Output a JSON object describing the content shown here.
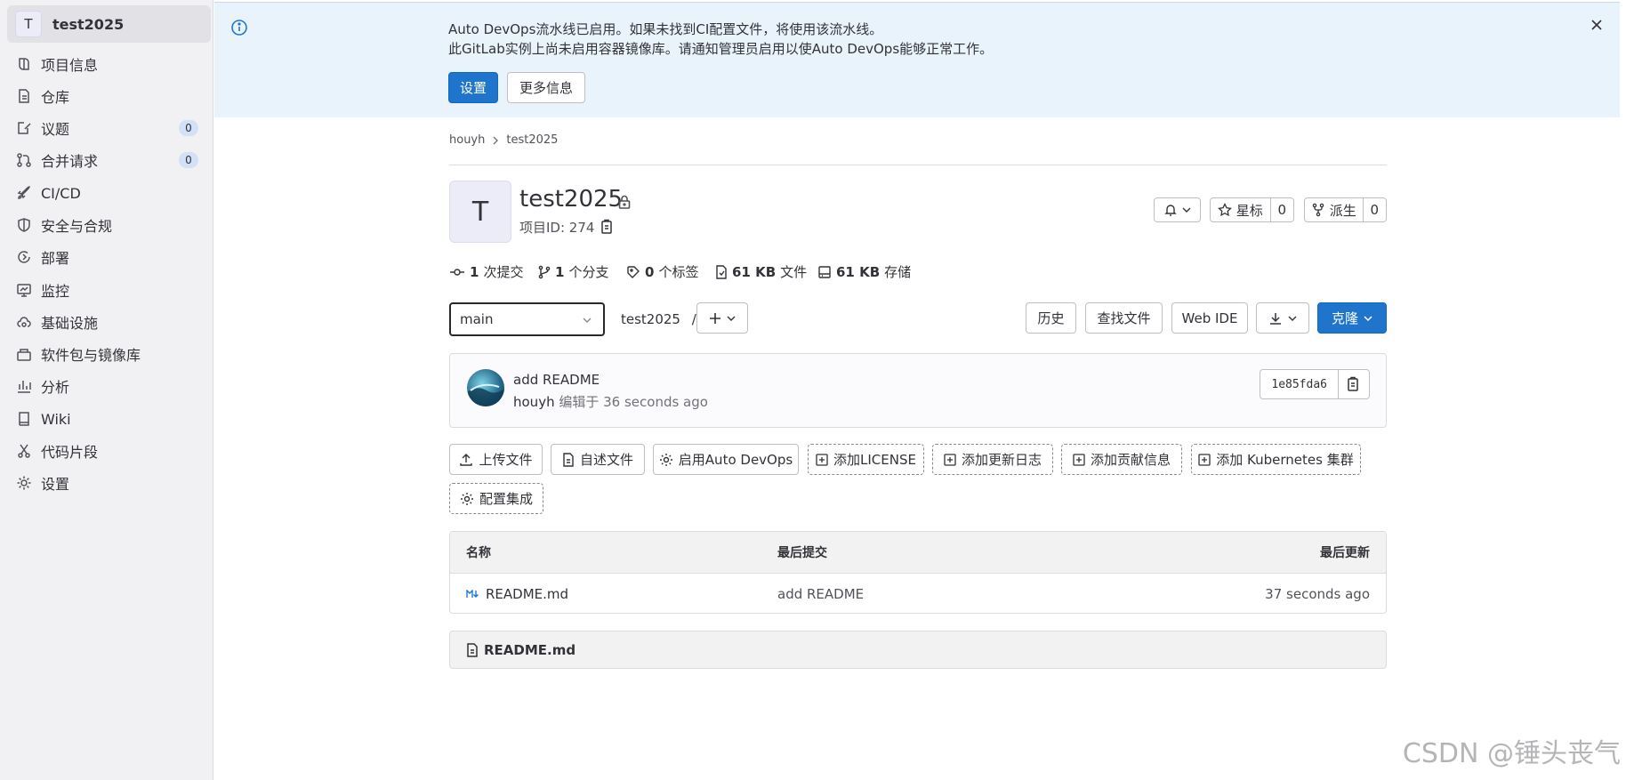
{
  "context": {
    "avatar_letter": "T",
    "name": "test2025"
  },
  "sidebar": {
    "items": [
      {
        "label": "项目信息",
        "icon": "project-icon"
      },
      {
        "label": "仓库",
        "icon": "document-icon"
      },
      {
        "label": "议题",
        "icon": "issues-icon",
        "count": "0"
      },
      {
        "label": "合并请求",
        "icon": "merge-request-icon",
        "count": "0"
      },
      {
        "label": "CI/CD",
        "icon": "rocket-icon"
      },
      {
        "label": "安全与合规",
        "icon": "shield-icon"
      },
      {
        "label": "部署",
        "icon": "deployments-icon"
      },
      {
        "label": "监控",
        "icon": "monitor-icon"
      },
      {
        "label": "基础设施",
        "icon": "cloud-gear-icon"
      },
      {
        "label": "软件包与镜像库",
        "icon": "package-icon"
      },
      {
        "label": "分析",
        "icon": "chart-icon"
      },
      {
        "label": "Wiki",
        "icon": "book-icon"
      },
      {
        "label": "代码片段",
        "icon": "snippet-icon"
      },
      {
        "label": "设置",
        "icon": "settings-icon"
      }
    ]
  },
  "banner": {
    "line1": "Auto DevOps流水线已启用。如果未找到CI配置文件，将使用该流水线。",
    "line2": "此GitLab实例上尚未启用容器镜像库。请通知管理员启用以使Auto DevOps能够正常工作。",
    "settings_button": "设置",
    "more_info_button": "更多信息"
  },
  "breadcrumb": {
    "owner": "houyh",
    "project": "test2025"
  },
  "project": {
    "avatar_letter": "T",
    "title": "test2025",
    "id_label": "项目ID: 274",
    "star_label": "星标",
    "star_count": "0",
    "fork_label": "派生",
    "fork_count": "0"
  },
  "stats": {
    "commits_num": "1",
    "commits_label": "次提交",
    "branches_num": "1",
    "branches_label": "个分支",
    "tags_num": "0",
    "tags_label": "个标签",
    "files_num": "61 KB",
    "files_label": "文件",
    "storage_num": "61 KB",
    "storage_label": "存储"
  },
  "toolbar": {
    "branch": "main",
    "path": "test2025",
    "path_sep": "/",
    "history": "历史",
    "find_file": "查找文件",
    "web_ide": "Web IDE",
    "clone": "克隆"
  },
  "commit": {
    "title": "add README",
    "author": "houyh",
    "meta": "编辑于 36 seconds ago",
    "sha": "1e85fda6"
  },
  "actions": {
    "upload": "上传文件",
    "readme": "自述文件",
    "autodevops": "启用Auto DevOps",
    "license": "添加LICENSE",
    "changelog": "添加更新日志",
    "contributing": "添加贡献信息",
    "kubernetes": "添加 Kubernetes 集群",
    "integrations": "配置集成"
  },
  "table": {
    "headers": {
      "name": "名称",
      "last_commit": "最后提交",
      "last_update": "最后更新"
    },
    "rows": [
      {
        "name": "README.md",
        "last_commit": "add README",
        "last_update": "37 seconds ago"
      }
    ]
  },
  "readme_panel": {
    "filename": "README.md"
  },
  "watermark": "CSDN @锤头丧气",
  "colors": {
    "primary": "#1f75cb",
    "banner_bg": "#e9f3fc",
    "sidebar_bg": "#f1f1f3"
  }
}
